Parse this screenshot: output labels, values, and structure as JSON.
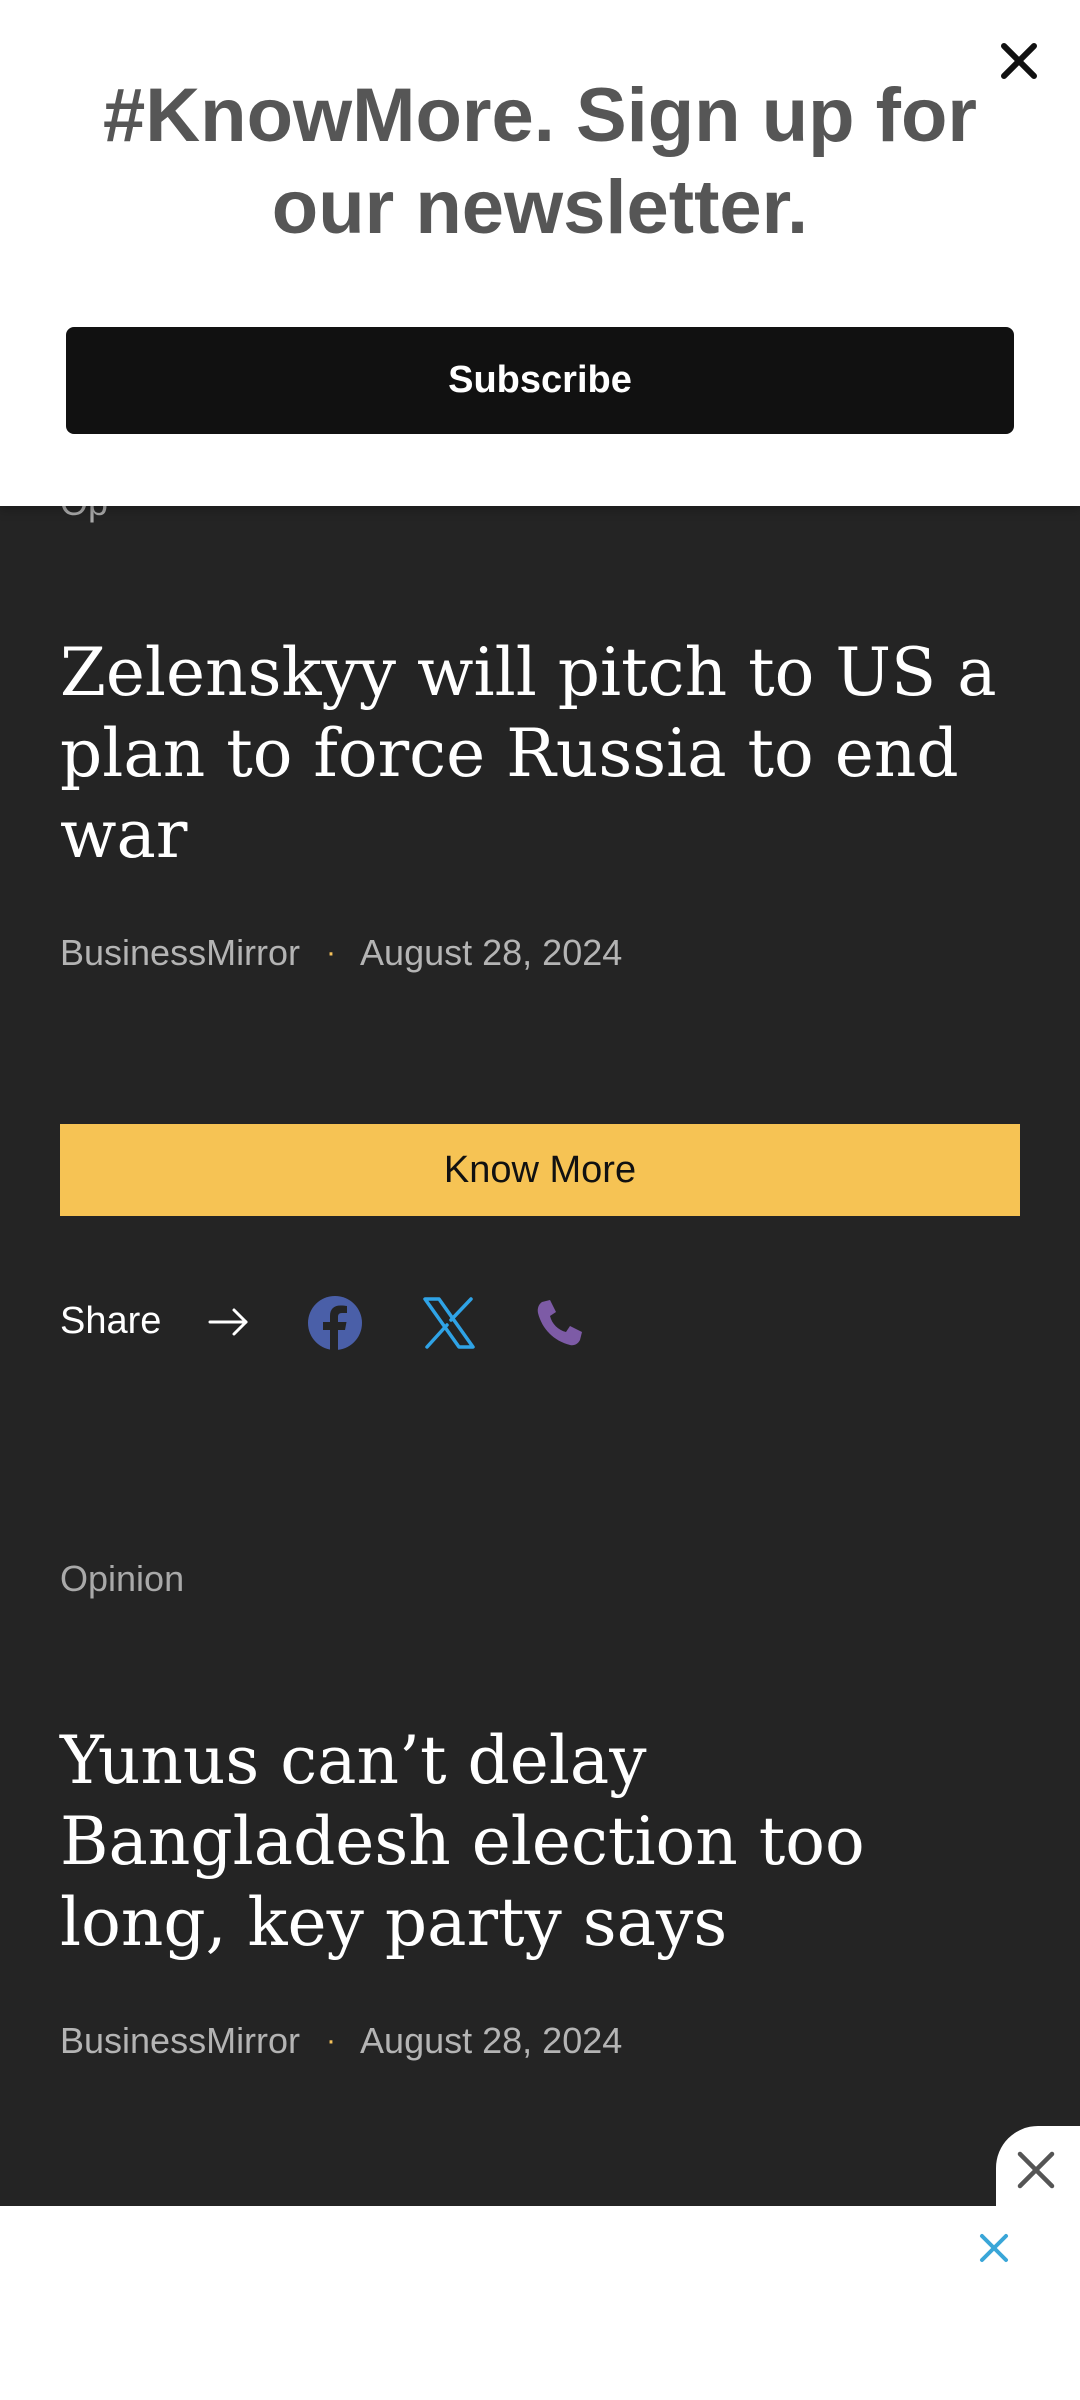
{
  "newsletter": {
    "title": "#KnowMore. Sign up for our newsletter.",
    "subscribe_label": "Subscribe",
    "close_icon": "close-icon"
  },
  "articles": [
    {
      "headline": "Zelenskyy will pitch to US a plan to force Russia to end war",
      "source": "BusinessMirror",
      "separator": "·",
      "date": "August 28, 2024"
    },
    {
      "category": "Opinion",
      "headline": "Yunus can’t delay Bangladesh election too long, key party says",
      "source": "BusinessMirror",
      "separator": "·",
      "date": "August 28, 2024"
    }
  ],
  "know_more_label": "Know More",
  "share": {
    "label": "Share",
    "icons": [
      "arrow-right-icon",
      "facebook-icon",
      "x-twitter-icon",
      "phone-icon"
    ]
  },
  "ad": {
    "close_icons": [
      "close-icon",
      "close-icon"
    ]
  },
  "colors": {
    "background": "#242424",
    "accent_yellow": "#f6c354",
    "facebook_blue": "#4a5fa8",
    "x_blue": "#2fa3e6",
    "phone_purple": "#7d5ba6",
    "ad_close_blue": "#3aa6d8"
  }
}
